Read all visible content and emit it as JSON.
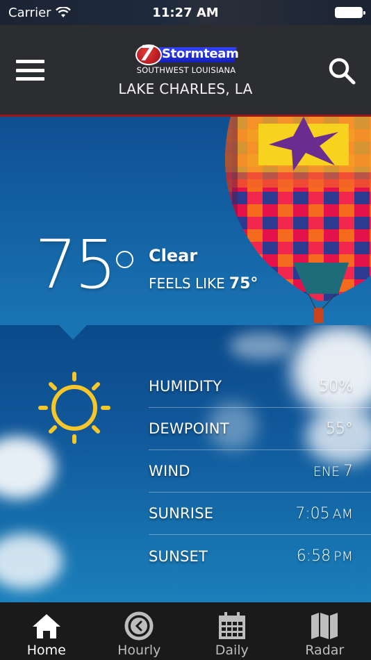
{
  "status_bar": {
    "carrier": "Carrier",
    "time": "11:27 AM",
    "wifi_icon": "wifi-icon",
    "battery_icon": "battery-full-icon"
  },
  "header": {
    "menu_icon": "hamburger-menu-icon",
    "search_icon": "search-icon",
    "logo": {
      "badge": "7",
      "name": "Stormteam",
      "subtitle": "SOUTHWEST LOUISIANA"
    },
    "location": "LAKE CHARLES, LA",
    "accent_color": "#a3141a"
  },
  "current": {
    "temperature": "75",
    "condition": "Clear",
    "feels_like_label": "FEELS LIKE",
    "feels_like_value": "75°"
  },
  "details": {
    "condition_icon": "sun-icon",
    "icon_color": "#f7c628",
    "rows": [
      {
        "label": "HUMIDITY",
        "prefix": "",
        "value": "50%",
        "unit": ""
      },
      {
        "label": "DEWPOINT",
        "prefix": "",
        "value": "55°",
        "unit": ""
      },
      {
        "label": "WIND",
        "prefix": "ENE",
        "value": "7",
        "unit": ""
      },
      {
        "label": "SUNRISE",
        "prefix": "",
        "value": "7:05",
        "unit": "AM"
      },
      {
        "label": "SUNSET",
        "prefix": "",
        "value": "6:58",
        "unit": "PM"
      }
    ]
  },
  "tabs": [
    {
      "label": "Home",
      "icon": "home-icon",
      "active": true
    },
    {
      "label": "Hourly",
      "icon": "clock-icon",
      "active": false
    },
    {
      "label": "Daily",
      "icon": "calendar-icon",
      "active": false
    },
    {
      "label": "Radar",
      "icon": "map-icon",
      "active": false
    }
  ]
}
